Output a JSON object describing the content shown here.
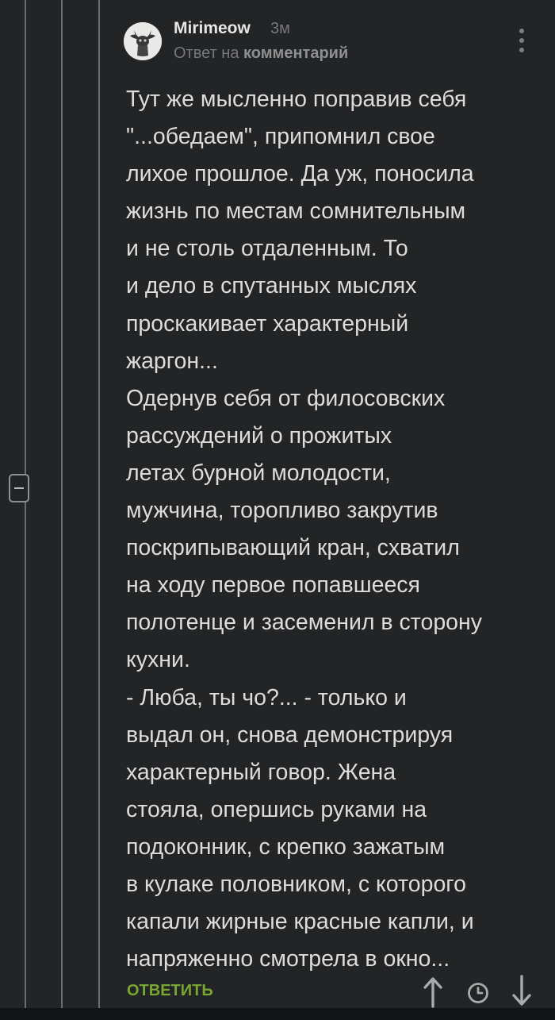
{
  "comment": {
    "author": "Mirimeow",
    "time": "3м",
    "reply_prefix": "Ответ на",
    "reply_link": "комментарий",
    "text": "Тут же мысленно поправив себя\n\"...обедаем\", припомнил свое\nлихое прошлое. Да уж, поносила\nжизнь по местам сомнительным\nи не столь отдаленным. То\nи дело в спутанных мыслях\nпроскакивает характерный\nжаргон...\nОдернув себя от филосовских\nрассуждений о прожитых\nлетах бурной молодости,\nмужчина, торопливо закрутив\nпоскрипывающий кран, схватил\nна ходу первое попавшееся\nполотенце и засеменил в сторону\nкухни.\n- Люба, ты чо?... - только и\nвыдал он, снова демонстрируя\nхарактерный говор. Жена\nстояла, опершись руками на\nподоконник, с крепко зажатым\nв кулаке половником, с которого\nкапали жирные красные капли, и\nнапряженно смотрела в окно...",
    "reply_button": "ОТВЕТИТЬ"
  },
  "icons": {
    "avatar": "avatar-cat-photo",
    "menu": "more-vertical-icon",
    "collapse": "minus-square-icon",
    "vote_up": "arrow-up-icon",
    "history": "clock-icon",
    "vote_down": "arrow-down-icon"
  },
  "colors": {
    "background": "#232425",
    "reply_accent": "#79a533",
    "text": "#dcdcdc",
    "muted": "#77787a"
  }
}
